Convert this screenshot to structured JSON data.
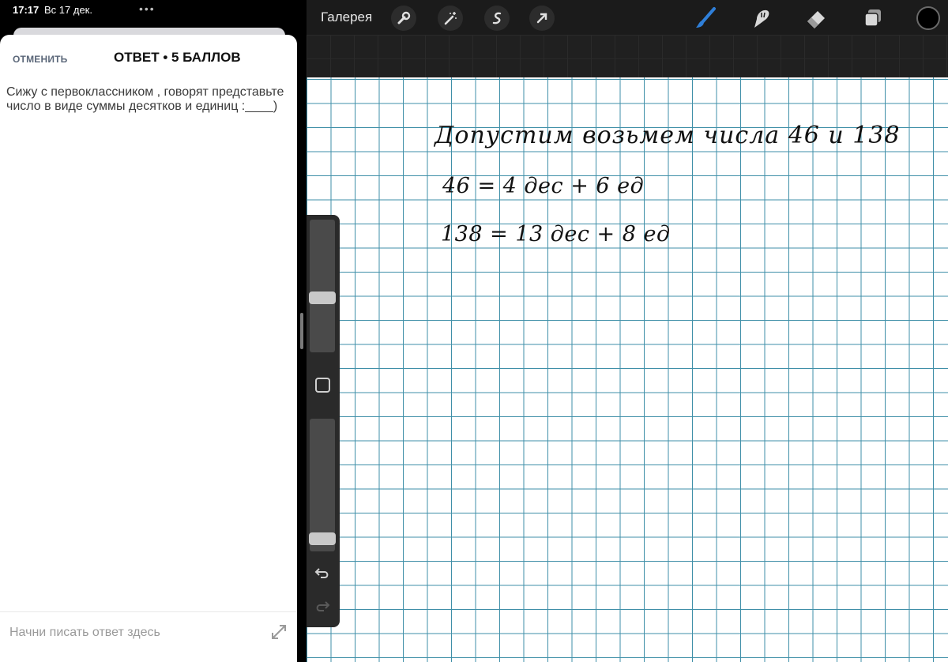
{
  "status": {
    "time": "17:17",
    "date": "Вс 17 дек.",
    "dots": "•••"
  },
  "answer_sheet": {
    "cancel_label": "ОТМЕНИТЬ",
    "title": "ОТВЕТ • 5 БАЛЛОВ",
    "question": "Сижу с первоклассником , говорят представьте число в виде суммы десятков и единиц :____)",
    "input_placeholder": "Начни писать ответ здесь",
    "expand_icon": "expand-arrows-icon"
  },
  "procreate": {
    "gallery_label": "Галерея",
    "tools_left": [
      "wrench-icon",
      "magic-wand-icon",
      "selection-icon",
      "move-arrow-icon"
    ],
    "tools_right": [
      "brush-icon",
      "smudge-icon",
      "eraser-icon",
      "layers-icon"
    ],
    "active_tool": "brush-icon",
    "accent_color": "#2f7fd8",
    "current_color": "#000000"
  },
  "canvas": {
    "paper": "grid",
    "grid_color": "#3f8fa8",
    "handwriting": [
      "Допустим возьмем числа 46 и 138",
      "46 = 4 дес + 6 ед",
      "138 = 13 дес + 8 ед"
    ]
  },
  "side_panel": {
    "size_level": 0.4,
    "opacity_level": 0.05
  }
}
